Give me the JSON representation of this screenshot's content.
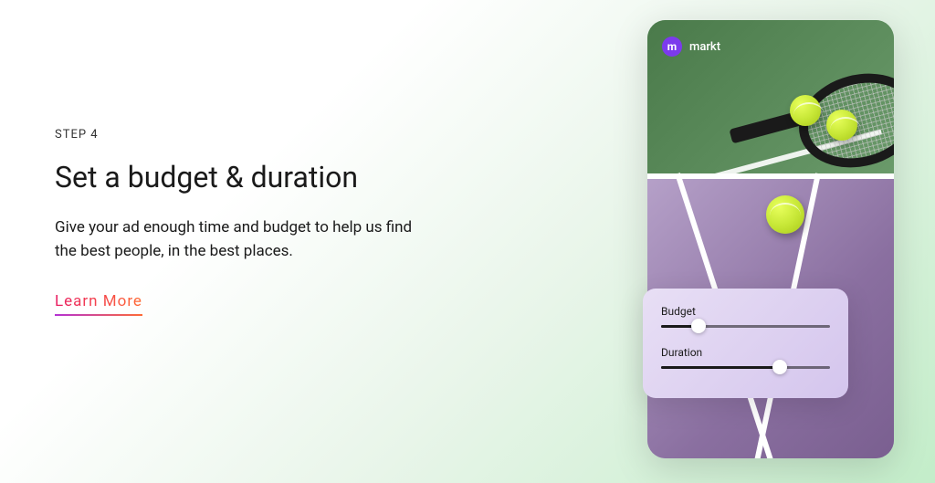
{
  "step_label": "STEP 4",
  "heading": "Set a budget & duration",
  "description": "Give your ad enough time and budget to help us find the best people, in the best places.",
  "cta": "Learn More",
  "phone": {
    "brand_icon_letter": "m",
    "brand_name": "markt"
  },
  "panel": {
    "budget": {
      "label": "Budget",
      "value_percent": 22
    },
    "duration": {
      "label": "Duration",
      "value_percent": 70
    }
  }
}
